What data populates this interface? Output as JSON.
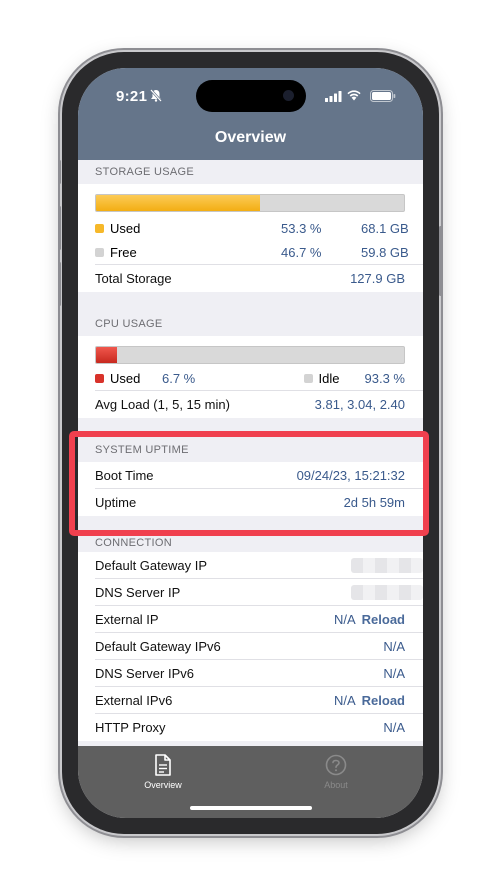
{
  "status_bar": {
    "time": "9:21"
  },
  "nav": {
    "title": "Overview"
  },
  "storage": {
    "header": "STORAGE USAGE",
    "used_fraction": 0.533,
    "used_label": "Used",
    "used_pct": "53.3 %",
    "used_size": "68.1 GB",
    "free_label": "Free",
    "free_pct": "46.7 %",
    "free_size": "59.8 GB",
    "total_label": "Total Storage",
    "total_size": "127.9 GB"
  },
  "cpu": {
    "header": "CPU USAGE",
    "used_fraction": 0.067,
    "used_label": "Used",
    "used_pct": "6.7 %",
    "idle_label": "Idle",
    "idle_pct": "93.3 %",
    "avg_label": "Avg Load (1, 5, 15 min)",
    "avg_value": "3.81, 3.04, 2.40"
  },
  "uptime": {
    "header": "SYSTEM UPTIME",
    "boot_label": "Boot Time",
    "boot_value": "09/24/23, 15:21:32",
    "uptime_label": "Uptime",
    "uptime_value": "2d 5h 59m"
  },
  "connection": {
    "header": "CONNECTION",
    "rows": [
      {
        "label": "Default Gateway IP"
      },
      {
        "label": "DNS Server IP"
      },
      {
        "label": "External IP",
        "value": "N/A",
        "action": "Reload"
      },
      {
        "label": "Default Gateway IPv6",
        "value": "N/A"
      },
      {
        "label": "DNS Server IPv6",
        "value": "N/A"
      },
      {
        "label": "External IPv6",
        "value": "N/A",
        "action": "Reload"
      },
      {
        "label": "HTTP Proxy",
        "value": "N/A"
      }
    ]
  },
  "tabs": [
    {
      "label": "Overview",
      "icon": "document-icon",
      "active": true
    },
    {
      "label": "About",
      "icon": "question-circle-icon",
      "active": false
    }
  ],
  "colors": {
    "nav_bg": "#65758a",
    "value_text": "#3a5a8c",
    "storage_used": "#f6b829",
    "cpu_used": "#d8322a",
    "highlight": "#f0404e",
    "tabbar_bg": "#5f5f5f"
  }
}
